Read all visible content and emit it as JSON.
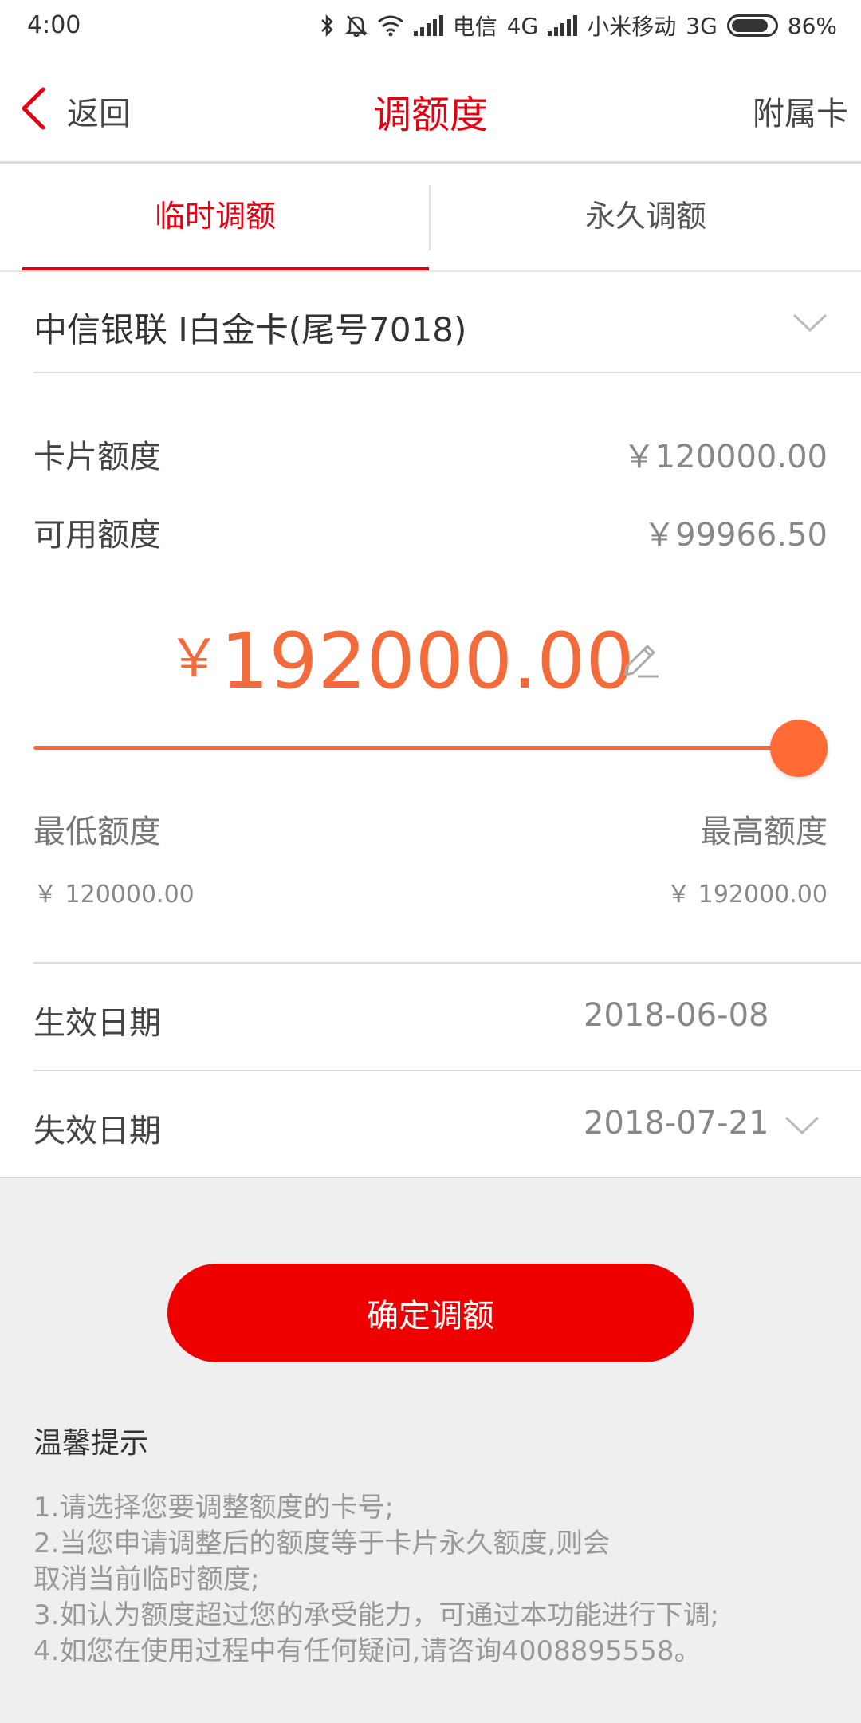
{
  "status_bar": {
    "time": "4:00",
    "carrier1": "电信",
    "network1": "4G",
    "carrier2": "小米移动",
    "network2": "3G",
    "battery": "86%"
  },
  "header": {
    "back_label": "返回",
    "title": "调额度",
    "right_action": "附属卡"
  },
  "tabs": [
    {
      "label": "临时调额",
      "active": true
    },
    {
      "label": "永久调额",
      "active": false
    }
  ],
  "card": {
    "name": "中信银联 I白金卡(尾号7018)"
  },
  "limits": {
    "card_limit_label": "卡片额度",
    "card_limit_value": "￥120000.00",
    "available_label": "可用额度",
    "available_value": "￥99966.50"
  },
  "adjust": {
    "currency": "￥",
    "amount": "192000.00",
    "slider_fraction": 1.0,
    "min_label": "最低额度",
    "min_value": "￥ 120000.00",
    "max_label": "最高额度",
    "max_value": "￥ 192000.00"
  },
  "dates": {
    "effective_label": "生效日期",
    "effective_value": "2018-06-08",
    "expiry_label": "失效日期",
    "expiry_value": "2018-07-21"
  },
  "confirm_label": "确定调额",
  "tips": {
    "title": "温馨提示",
    "lines": [
      "1.请选择您要调整额度的卡号;",
      "2.当您申请调整后的额度等于卡片永久额度,则会",
      "取消当前临时额度;",
      "3.如认为额度超过您的承受能力，可通过本功能进行下调;",
      "4.如您在使用过程中有任何疑问,请咨询4008895558。"
    ]
  },
  "colors": {
    "brand_red": "#e60012",
    "amount_orange": "#f36b3b",
    "button_red": "#ee0000"
  }
}
